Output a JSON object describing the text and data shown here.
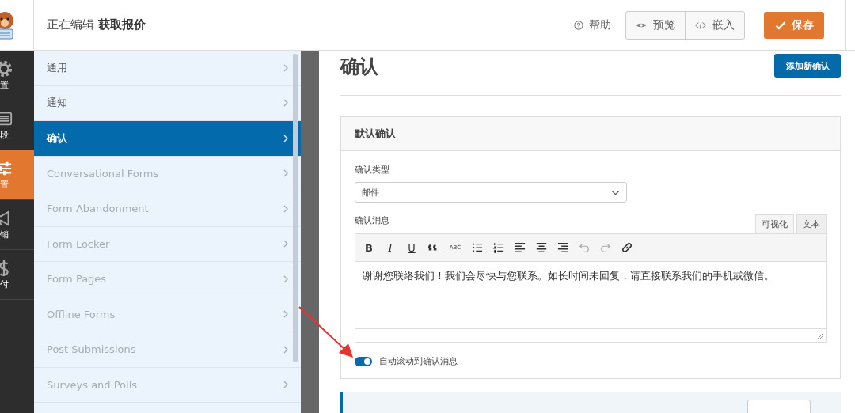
{
  "header": {
    "title_prefix": "正在编辑",
    "form_name": "获取报价",
    "help": "帮助",
    "preview": "预览",
    "embed": "嵌入",
    "save": "保存"
  },
  "icon_nav": [
    {
      "kind": "gear",
      "label": "置",
      "selected": false
    },
    {
      "kind": "fields",
      "label": "段",
      "selected": false
    },
    {
      "kind": "sliders",
      "label": "置",
      "selected": true
    },
    {
      "kind": "megaphone",
      "label": "销",
      "selected": false
    },
    {
      "kind": "dollar",
      "label": "付",
      "selected": false
    }
  ],
  "settings_menu": [
    {
      "label": "通用",
      "selected": false,
      "disabled": false
    },
    {
      "label": "通知",
      "selected": false,
      "disabled": false
    },
    {
      "label": "确认",
      "selected": true,
      "disabled": false
    },
    {
      "label": "Conversational Forms",
      "selected": false,
      "disabled": true
    },
    {
      "label": "Form Abandonment",
      "selected": false,
      "disabled": true
    },
    {
      "label": "Form Locker",
      "selected": false,
      "disabled": true
    },
    {
      "label": "Form Pages",
      "selected": false,
      "disabled": true
    },
    {
      "label": "Offline Forms",
      "selected": false,
      "disabled": true
    },
    {
      "label": "Post Submissions",
      "selected": false,
      "disabled": true
    },
    {
      "label": "Surveys and Polls",
      "selected": false,
      "disabled": true
    }
  ],
  "content": {
    "title": "确认",
    "add_button": "添加新确认",
    "panel": {
      "title": "默认确认",
      "type_label": "确认类型",
      "type_value": "邮件",
      "message_label": "确认消息",
      "editor_tabs": [
        {
          "label": "可视化",
          "selected": true
        },
        {
          "label": "文本",
          "selected": false
        }
      ],
      "toolbar": [
        {
          "kind": "bold",
          "label": "B"
        },
        {
          "kind": "italic",
          "label": "I"
        },
        {
          "kind": "underline",
          "label": "U"
        },
        {
          "kind": "quote"
        },
        {
          "kind": "strike",
          "label": "ABC"
        },
        {
          "kind": "bullet-list"
        },
        {
          "kind": "number-list"
        },
        {
          "kind": "align-left"
        },
        {
          "kind": "align-center"
        },
        {
          "kind": "align-right"
        },
        {
          "kind": "undo"
        },
        {
          "kind": "redo"
        },
        {
          "kind": "link"
        }
      ],
      "message": "谢谢您联络我们！我们会尽快与您联系。如长时间未回复，请直接联系我们的手机或微信。",
      "toggle": {
        "label": "自动滚动到确认消息",
        "on": true
      }
    }
  }
}
